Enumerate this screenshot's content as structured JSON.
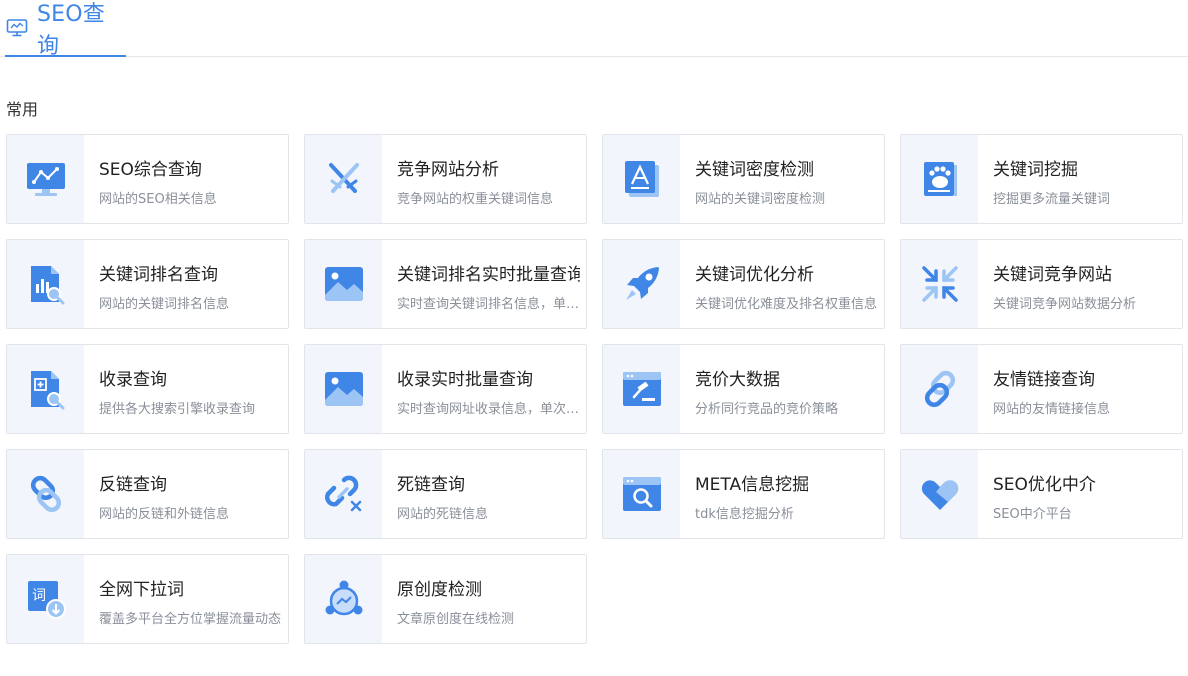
{
  "header": {
    "title": "SEO查询"
  },
  "section": {
    "label": "常用"
  },
  "colors": {
    "accent": "#3f86e6",
    "accent_light": "#9cc4f5",
    "icon_bg": "#f2f6fc"
  },
  "cards": [
    {
      "title": "SEO综合查询",
      "desc": "网站的SEO相关信息",
      "icon": "monitor-chart-icon"
    },
    {
      "title": "竞争网站分析",
      "desc": "竞争网站的权重关键词信息",
      "icon": "crossed-swords-icon"
    },
    {
      "title": "关键词密度检测",
      "desc": "网站的关键词密度检测",
      "icon": "letter-a-document-icon"
    },
    {
      "title": "关键词挖掘",
      "desc": "挖掘更多流量关键词",
      "icon": "baidu-paw-icon"
    },
    {
      "title": "关键词排名查询",
      "desc": "网站的关键词排名信息",
      "icon": "document-search-chart-icon"
    },
    {
      "title": "关键词排名实时批量查询",
      "desc": "实时查询关键词排名信息，单…",
      "icon": "image-mountain-icon"
    },
    {
      "title": "关键词优化分析",
      "desc": "关键词优化难度及排名权重信息",
      "icon": "rocket-icon"
    },
    {
      "title": "关键词竞争网站",
      "desc": "关键词竞争网站数据分析",
      "icon": "compress-arrows-icon"
    },
    {
      "title": "收录查询",
      "desc": "提供各大搜索引擎收录查询",
      "icon": "document-plus-search-icon"
    },
    {
      "title": "收录实时批量查询",
      "desc": "实时查询网址收录信息，单次…",
      "icon": "image-mountain-icon"
    },
    {
      "title": "竞价大数据",
      "desc": "分析同行竞品的竞价策略",
      "icon": "auction-hammer-icon"
    },
    {
      "title": "友情链接查询",
      "desc": "网站的友情链接信息",
      "icon": "link-icon"
    },
    {
      "title": "反链查询",
      "desc": "网站的反链和外链信息",
      "icon": "reverse-link-icon"
    },
    {
      "title": "死链查询",
      "desc": "网站的死链信息",
      "icon": "broken-link-icon"
    },
    {
      "title": "META信息挖掘",
      "desc": "tdk信息挖掘分析",
      "icon": "browser-search-icon"
    },
    {
      "title": "SEO优化中介",
      "desc": "SEO中介平台",
      "icon": "heart-handshake-icon"
    },
    {
      "title": "全网下拉词",
      "desc": "覆盖多平台全方位掌握流量动态",
      "icon": "word-download-icon"
    },
    {
      "title": "原创度检测",
      "desc": "文章原创度在线检测",
      "icon": "network-nodes-icon"
    }
  ]
}
